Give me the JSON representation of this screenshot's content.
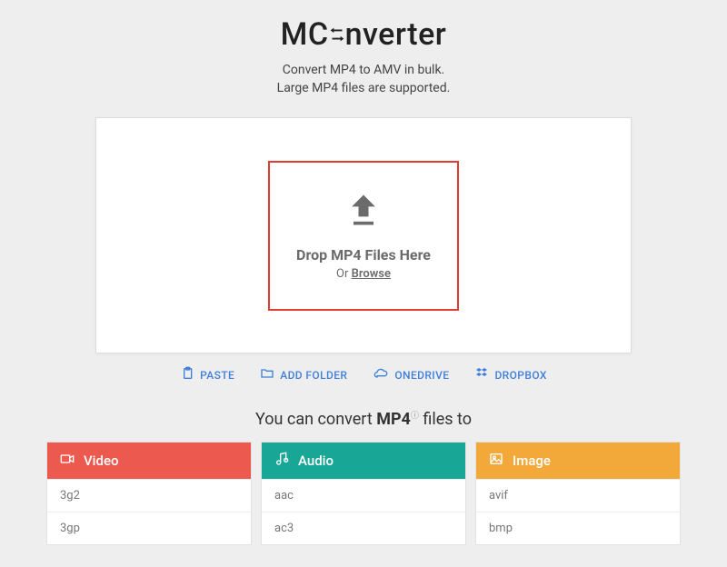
{
  "header": {
    "logo_prefix": "MC",
    "logo_suffix": "nverter",
    "subtitle_line1": "Convert MP4 to AMV in bulk.",
    "subtitle_line2": "Large MP4 files are supported."
  },
  "dropzone": {
    "title": "Drop MP4 Files Here",
    "or_text": "Or ",
    "browse": "Browse"
  },
  "sources": {
    "paste": "PASTE",
    "add_folder": "ADD FOLDER",
    "onedrive": "ONEDRIVE",
    "dropbox": "DROPBOX"
  },
  "convert": {
    "prefix": "You can convert ",
    "format": "MP4",
    "info_mark": "ⓘ",
    "suffix": " files to"
  },
  "categories": {
    "video": {
      "label": "Video",
      "items": [
        "3g2",
        "3gp"
      ]
    },
    "audio": {
      "label": "Audio",
      "items": [
        "aac",
        "ac3"
      ]
    },
    "image": {
      "label": "Image",
      "items": [
        "avif",
        "bmp"
      ]
    }
  },
  "colors": {
    "accent_blue": "#3f7fdb",
    "video": "#ec5a4f",
    "audio": "#18a797",
    "image": "#f3a93a",
    "highlight_border": "#e03c31"
  }
}
